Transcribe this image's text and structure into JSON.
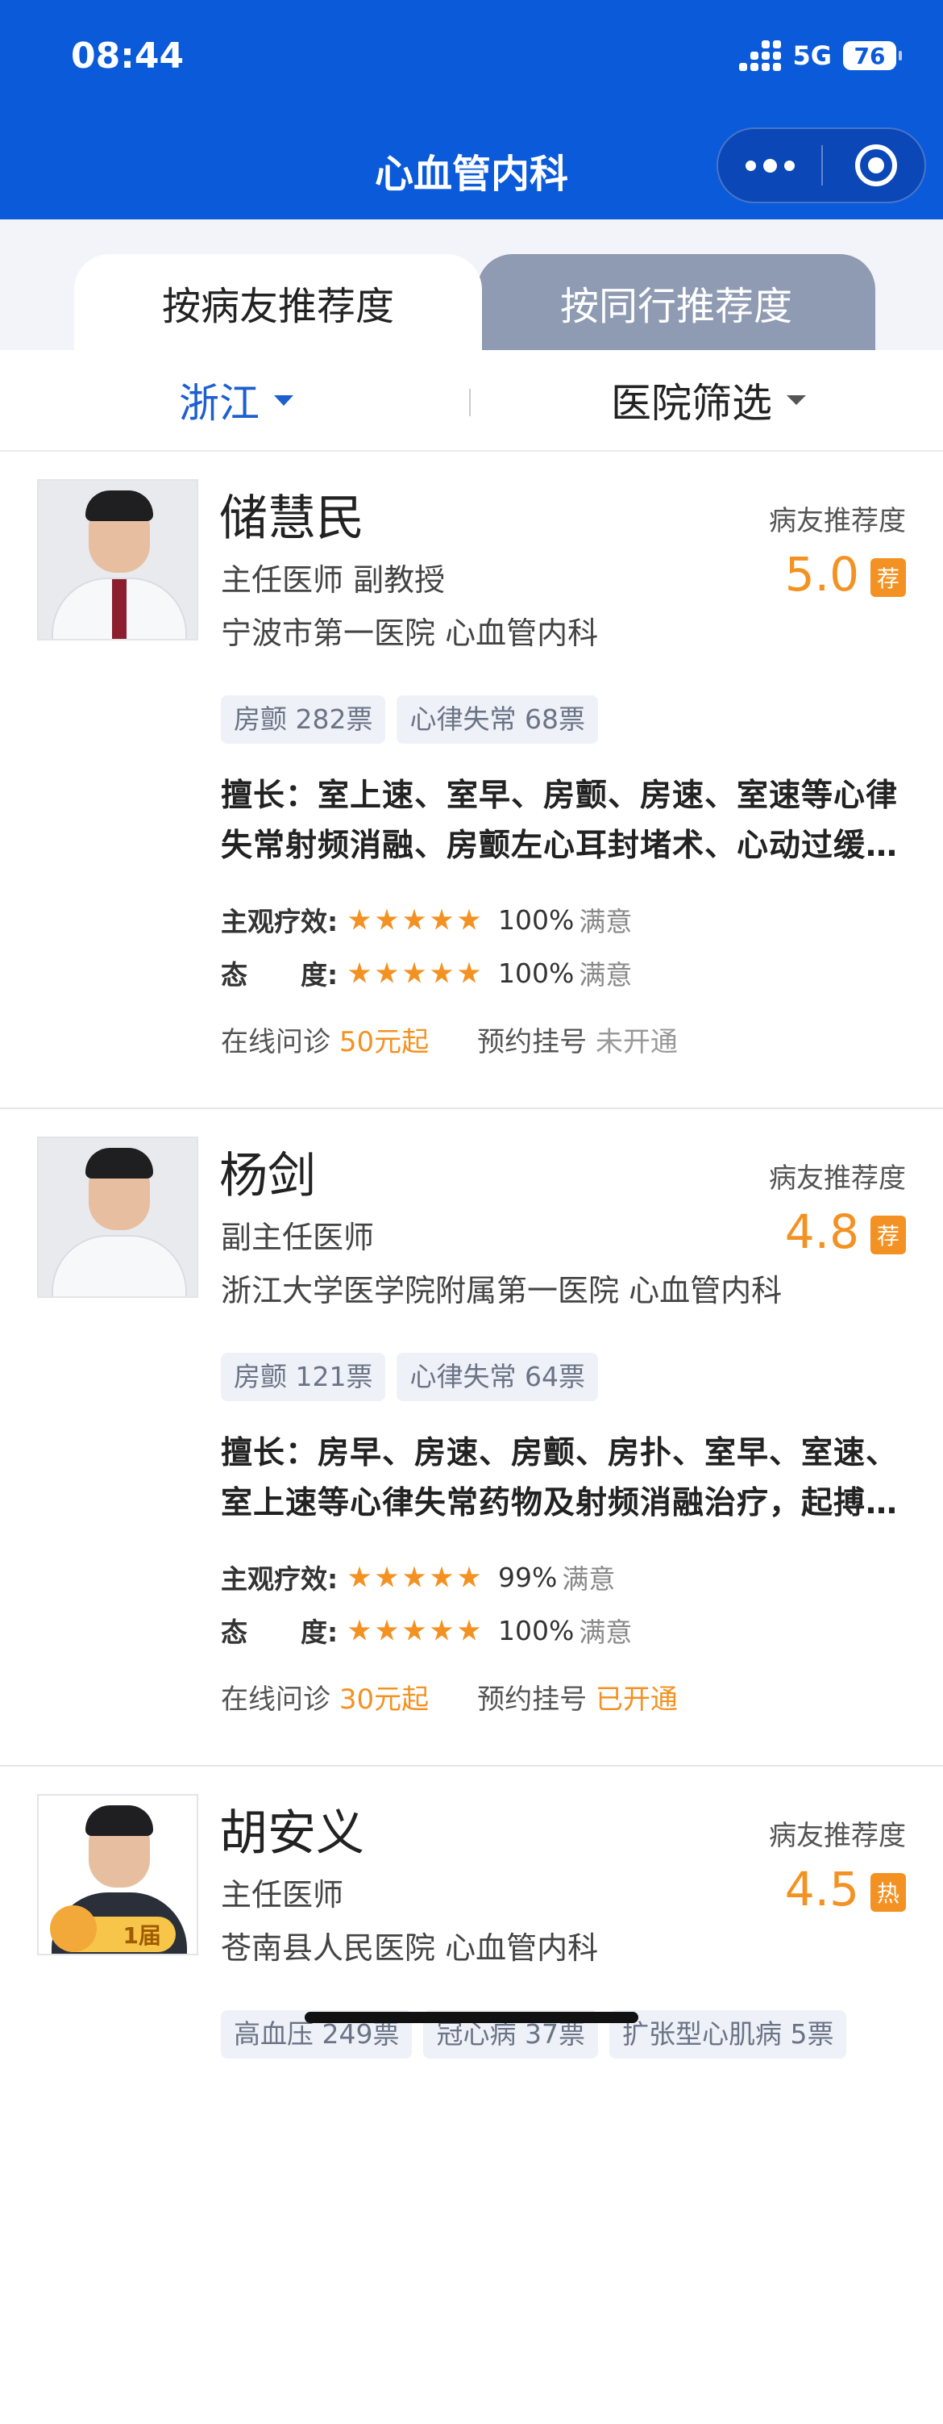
{
  "status_bar": {
    "time": "08:44",
    "network": "5G",
    "battery": "76"
  },
  "nav": {
    "title": "心血管内科"
  },
  "tabs": [
    {
      "label": "按病友推荐度",
      "active": true
    },
    {
      "label": "按同行推荐度",
      "active": false
    }
  ],
  "filters": {
    "region": "浙江",
    "hospital": "医院筛选"
  },
  "labels": {
    "recommend": "病友推荐度",
    "effect": "主观疗效:",
    "attitude": "态　　度:",
    "satisfied": "满意",
    "online": "在线问诊",
    "appoint": "预约挂号"
  },
  "doctors": [
    {
      "name": "储慧民",
      "title": "主任医师 副教授",
      "hospital": "宁波市第一医院 心血管内科",
      "score": "5.0",
      "badge": "荐",
      "tags": [
        "房颤 282票",
        "心律失常 68票"
      ],
      "expertise": "擅长：室上速、室早、房颤、房速、室速等心律失常射频消融、房颤左心耳封堵术、心动过缓起搏器植入",
      "effect_pct": "100%",
      "attitude_pct": "100%",
      "online_price": "50元起",
      "appoint_status": "未开通"
    },
    {
      "name": "杨剑",
      "title": "副主任医师",
      "hospital": "浙江大学医学院附属第一医院 心血管内科",
      "score": "4.8",
      "badge": "荐",
      "tags": [
        "房颤 121票",
        "心律失常 64票"
      ],
      "expertise": "擅长：房早、房速、房颤、房扑、室早、室速、室上速等心律失常药物及射频消融治疗，起搏器植入",
      "effect_pct": "99%",
      "attitude_pct": "100%",
      "online_price": "30元起",
      "appoint_status": "已开通"
    },
    {
      "name": "胡安义",
      "title": "主任医师",
      "hospital": "苍南县人民医院 心血管内科",
      "score": "4.5",
      "badge": "热",
      "photo_badge": "1届",
      "tags": [
        "高血压 249票",
        "冠心病 37票",
        "扩张型心肌病 5票"
      ]
    }
  ],
  "colors": {
    "brand_blue": "#0a5ad9",
    "accent_orange": "#f39222"
  }
}
